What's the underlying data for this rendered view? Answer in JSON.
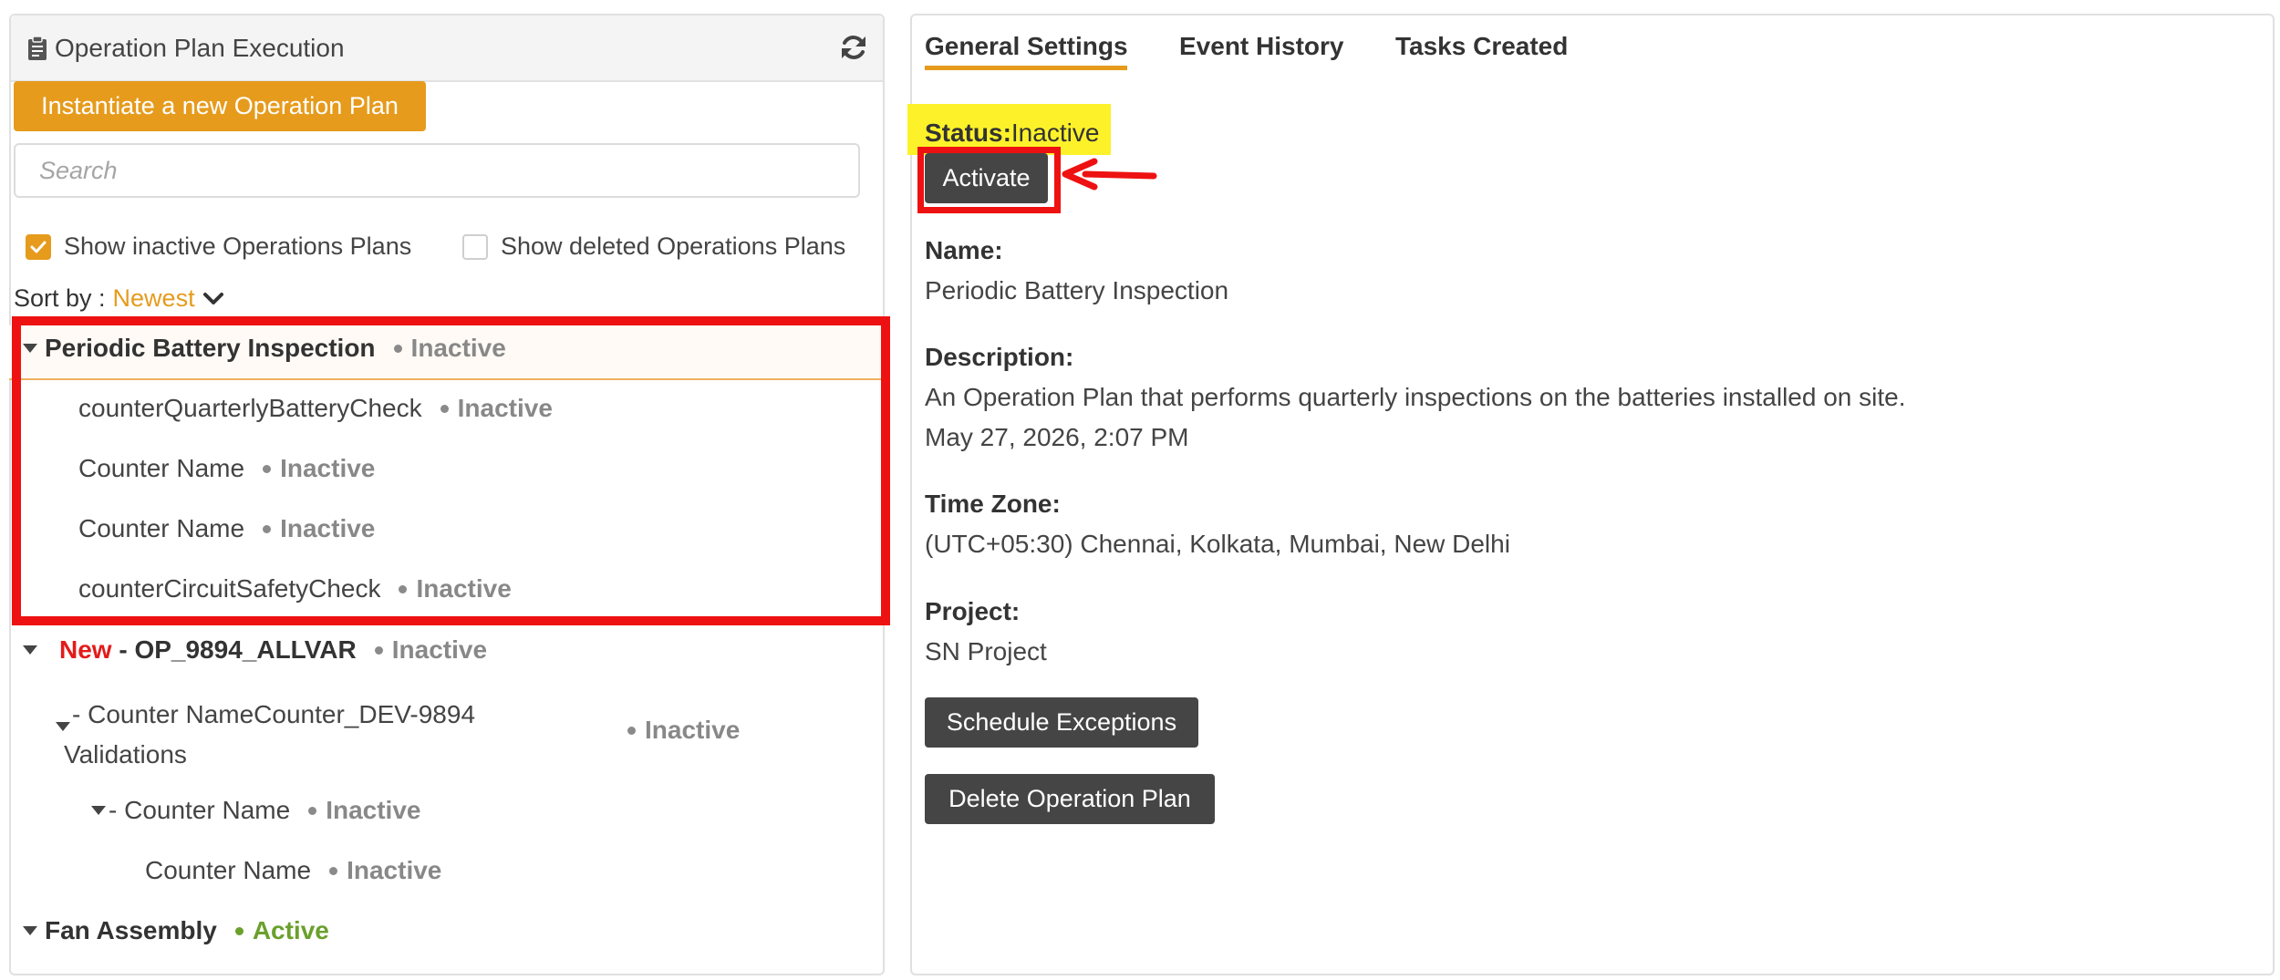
{
  "left_panel": {
    "title": "Operation Plan Execution",
    "instantiate_label": "Instantiate a new Operation Plan",
    "search_placeholder": "Search",
    "show_inactive_label": "Show inactive Operations Plans",
    "show_inactive_checked": true,
    "show_deleted_label": "Show deleted Operations Plans",
    "show_deleted_checked": false,
    "sort_label": "Sort by :",
    "sort_value": "Newest",
    "tree": [
      {
        "name": "Periodic Battery Inspection",
        "status": "Inactive"
      },
      {
        "name": "counterQuarterlyBatteryCheck",
        "status": "Inactive"
      },
      {
        "name": "Counter Name",
        "status": "Inactive"
      },
      {
        "name": "Counter Name",
        "status": "Inactive"
      },
      {
        "name": "counterCircuitSafetyCheck",
        "status": "Inactive"
      },
      {
        "prefix": "New",
        "name": " - OP_9894_ALLVAR",
        "status": "Inactive"
      },
      {
        "name_line1": "- Counter NameCounter_DEV-9894",
        "name_line2": "Validations",
        "status": "Inactive"
      },
      {
        "name": "- Counter Name",
        "status": "Inactive"
      },
      {
        "name": "Counter Name",
        "status": "Inactive"
      },
      {
        "name": "Fan Assembly",
        "status": "Active"
      }
    ]
  },
  "right_panel": {
    "tabs": [
      "General Settings",
      "Event History",
      "Tasks Created"
    ],
    "active_tab": "General Settings",
    "status_label": "Status:",
    "status_value": "Inactive",
    "activate_label": "Activate",
    "name_label": "Name:",
    "name_value": "Periodic Battery Inspection",
    "description_label": "Description:",
    "description_value": "An Operation Plan that performs quarterly inspections on the batteries installed on site.",
    "date_value": "May 27, 2026, 2:07 PM",
    "timezone_label": "Time Zone:",
    "timezone_value": "(UTC+05:30) Chennai, Kolkata, Mumbai, New Delhi",
    "project_label": "Project:",
    "project_value": "SN Project",
    "schedule_exceptions_label": "Schedule Exceptions",
    "delete_label": "Delete Operation Plan"
  },
  "colors": {
    "accent": "#e69b1d",
    "active_status": "#6aa02c",
    "inactive_status": "#888888",
    "new_tag": "#e31b1b",
    "annotation_red": "#ee1111",
    "status_highlight": "#fdf22a",
    "dark_button": "#454545"
  },
  "icons": [
    "clipboard-icon",
    "refresh-icon",
    "check-icon",
    "chevron-down-icon",
    "caret-down-icon",
    "status-dot-icon",
    "red-arrow-annotation"
  ]
}
